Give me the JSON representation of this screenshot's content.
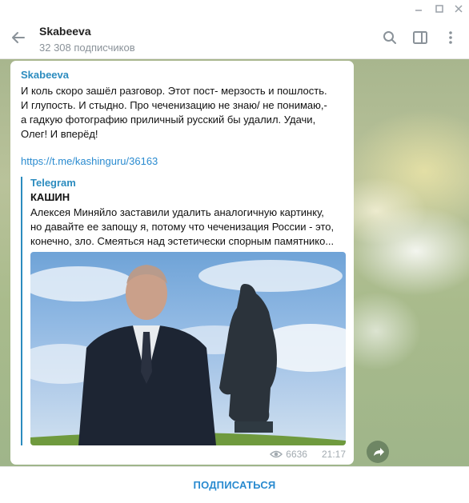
{
  "window": {
    "minimize_icon": "minimize-icon",
    "maximize_icon": "maximize-icon",
    "close_icon": "close-icon"
  },
  "header": {
    "title": "Skabeeva",
    "subtitle": "32 308 подписчиков",
    "icons": [
      "back-arrow-icon",
      "search-icon",
      "side-panel-icon",
      "more-vertical-icon"
    ]
  },
  "message": {
    "author": "Skabeeva",
    "text": "И коль скоро зашёл разговор. Этот пост- мерзость и пошлость.\nИ глупость. И стыдно. Про чеченизацию не знаю/ не понимаю,-\nа гадкую фотографию приличный русский бы удалил. Удачи,\nОлег! И вперёд!",
    "link": "https://t.me/kashinguru/36163",
    "preview": {
      "source": "Telegram",
      "title": "КАШИН",
      "lines": [
        "Алексея Миняйло заставили удалить аналогичную картинку,",
        "но давайте ее запощу я, потому что чеченизация России - это,",
        "конечно, зло. Смеяться над эстетически спорным памятнико..."
      ]
    },
    "views": "6636",
    "time": "21:17"
  },
  "bottom": {
    "subscribe_label": "ПОДПИСАТЬСЯ"
  },
  "colors": {
    "accent": "#2c8cbf",
    "link": "#2a8bd0",
    "muted": "#8a9299"
  }
}
